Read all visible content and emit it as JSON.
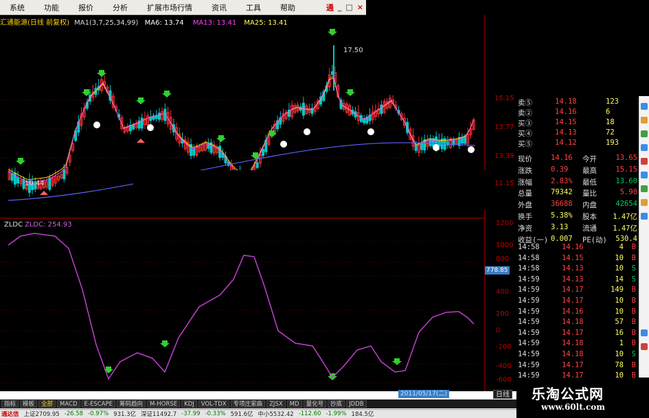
{
  "menu": {
    "items": [
      "系统",
      "功能",
      "报价",
      "分析",
      "扩展市场行情",
      "资讯",
      "工具",
      "帮助"
    ],
    "right_label": "通",
    "controls": [
      "_",
      "□",
      "×"
    ]
  },
  "chart": {
    "name": "汇通能源(日线 前复权)",
    "ma_label": "MA1(3,7,25,34,99)",
    "ma6": "MA6: 13.74",
    "ma13": "MA13: 13.41",
    "ma25": "MA25: 13.41",
    "high_mark": "17.50",
    "low_mark": "10.44",
    "price_ticks": [
      "15.15",
      "13.77",
      "13.39",
      "11.15"
    ],
    "colors": {
      "up": "#ff3030",
      "down": "#00c8c8",
      "ma6": "#ffffff",
      "ma13": "#ff40ff",
      "ma25": "#e8e000",
      "ma99": "#6060ff",
      "indicator": "#c040d0",
      "axis": "#c00000"
    }
  },
  "indicator": {
    "label": "ZLDC",
    "value_label": "ZLDC: 254.93",
    "axis_ticks": [
      "1200",
      "1000",
      "800",
      "400",
      "200",
      "0",
      "-200",
      "-400",
      "-600"
    ],
    "badge": "778.85"
  },
  "quote": {
    "asks": [
      {
        "label": "卖⑤",
        "price": "14.18",
        "vol": "123"
      },
      {
        "label": "卖②",
        "price": "14.16",
        "vol": "6"
      },
      {
        "label": "买③",
        "price": "14.15",
        "vol": "18"
      },
      {
        "label": "买④",
        "price": "14.13",
        "vol": "72"
      },
      {
        "label": "买⑤",
        "price": "14.12",
        "vol": "193"
      }
    ],
    "stats": [
      {
        "l1": "现价",
        "v1": "14.16",
        "l2": "今开",
        "v2": "13.65"
      },
      {
        "l1": "涨跌",
        "v1": "0.39",
        "l2": "最高",
        "v2": "15.15"
      },
      {
        "l1": "涨幅",
        "v1": "2.83%",
        "l2": "最低",
        "v2": "13.60"
      },
      {
        "l1": "总量",
        "v1": "79342",
        "l2": "量比",
        "v2": "5.90"
      },
      {
        "l1": "外盘",
        "v1": "36688",
        "l2": "内盘",
        "v2": "42654"
      },
      {
        "l1": "换手",
        "v1": "5.38%",
        "l2": "股本",
        "v2": "1.47亿"
      },
      {
        "l1": "净资",
        "v1": "3.13",
        "l2": "流通",
        "v2": "1.47亿"
      },
      {
        "l1": "收益(一)",
        "v1": "0.007",
        "l2": "PE(动)",
        "v2": "530.4"
      }
    ],
    "ticks": [
      {
        "time": "14:58",
        "price": "14.16",
        "vol": "4",
        "dir": "B"
      },
      {
        "time": "14:58",
        "price": "14.15",
        "vol": "10",
        "dir": "B"
      },
      {
        "time": "14:58",
        "price": "14.13",
        "vol": "10",
        "dir": "S"
      },
      {
        "time": "14:59",
        "price": "14.13",
        "vol": "14",
        "dir": "S"
      },
      {
        "time": "14:59",
        "price": "14.17",
        "vol": "149",
        "dir": "B"
      },
      {
        "time": "14:59",
        "price": "14.17",
        "vol": "10",
        "dir": "B"
      },
      {
        "time": "14:59",
        "price": "14.16",
        "vol": "10",
        "dir": "B"
      },
      {
        "time": "14:59",
        "price": "14.18",
        "vol": "57",
        "dir": "B"
      },
      {
        "time": "14:59",
        "price": "14.17",
        "vol": "16",
        "dir": "B"
      },
      {
        "time": "14:59",
        "price": "14.18",
        "vol": "1",
        "dir": "B"
      },
      {
        "time": "14:59",
        "price": "14.18",
        "vol": "10",
        "dir": "S"
      },
      {
        "time": "14:59",
        "price": "14.17",
        "vol": "78",
        "dir": "B"
      },
      {
        "time": "14:59",
        "price": "14.17",
        "vol": "10",
        "dir": "B"
      }
    ]
  },
  "tabs": [
    "指标",
    "模板",
    "全部",
    "MACD",
    "E-ESCAPE",
    "筹码趋向",
    "M-HORSE",
    "KDJ",
    "VOL-TDX",
    "专项庄家曲",
    "ZJSX",
    "MD",
    "量化号",
    "抄底",
    "JDDB"
  ],
  "date_badge": "2011/05/17(二)",
  "day_button": "日线",
  "status": [
    "上证2709.95",
    "-26.58",
    "-0.97%",
    "931.3亿",
    "深证11492.7",
    "-37.99",
    "-0.33%",
    "591.6亿",
    "中小5532.42",
    "-112.60",
    "-1.99%",
    "184.5亿"
  ],
  "status_left": "通达信",
  "watermark": {
    "title": "乐淘公式网",
    "url": "www.60lt.com"
  }
}
